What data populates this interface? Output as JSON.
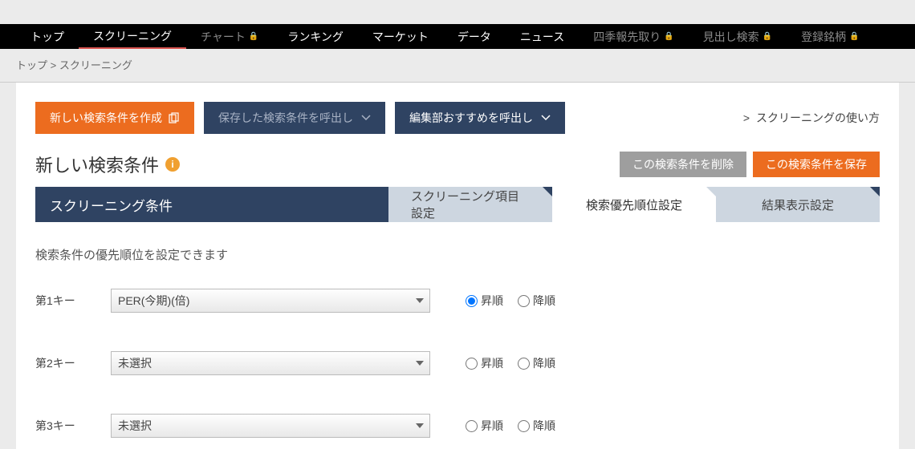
{
  "nav": {
    "items": [
      {
        "label": "トップ",
        "locked": false,
        "active": false
      },
      {
        "label": "スクリーニング",
        "locked": false,
        "active": true
      },
      {
        "label": "チャート",
        "locked": true,
        "active": false
      },
      {
        "label": "ランキング",
        "locked": false,
        "active": false
      },
      {
        "label": "マーケット",
        "locked": false,
        "active": false
      },
      {
        "label": "データ",
        "locked": false,
        "active": false
      },
      {
        "label": "ニュース",
        "locked": false,
        "active": false
      },
      {
        "label": "四季報先取り",
        "locked": true,
        "active": false
      },
      {
        "label": "見出し検索",
        "locked": true,
        "active": false
      },
      {
        "label": "登録銘柄",
        "locked": true,
        "active": false
      }
    ]
  },
  "breadcrumb": {
    "home": "トップ",
    "sep": ">",
    "current": "スクリーニング"
  },
  "top_actions": {
    "create_label": "新しい検索条件を作成",
    "load_saved_label": "保存した検索条件を呼出し",
    "load_recommended_label": "編集部おすすめを呼出し",
    "usage_link": "スクリーニングの使い方"
  },
  "title": "新しい検索条件",
  "title_actions": {
    "delete_label": "この検索条件を削除",
    "save_label": "この検索条件を保存"
  },
  "tabs": {
    "header": "スクリーニング条件",
    "items": [
      {
        "label": "スクリーニング項目設定",
        "active": false
      },
      {
        "label": "検索優先順位設定",
        "active": true
      },
      {
        "label": "結果表示設定",
        "active": false
      }
    ]
  },
  "description": "検索条件の優先順位を設定できます",
  "keys": [
    {
      "label": "第1キー",
      "value": "PER(今期)(倍)",
      "asc": "昇順",
      "desc": "降順",
      "checked": "asc"
    },
    {
      "label": "第2キー",
      "value": "未選択",
      "asc": "昇順",
      "desc": "降順",
      "checked": ""
    },
    {
      "label": "第3キー",
      "value": "未選択",
      "asc": "昇順",
      "desc": "降順",
      "checked": ""
    }
  ]
}
